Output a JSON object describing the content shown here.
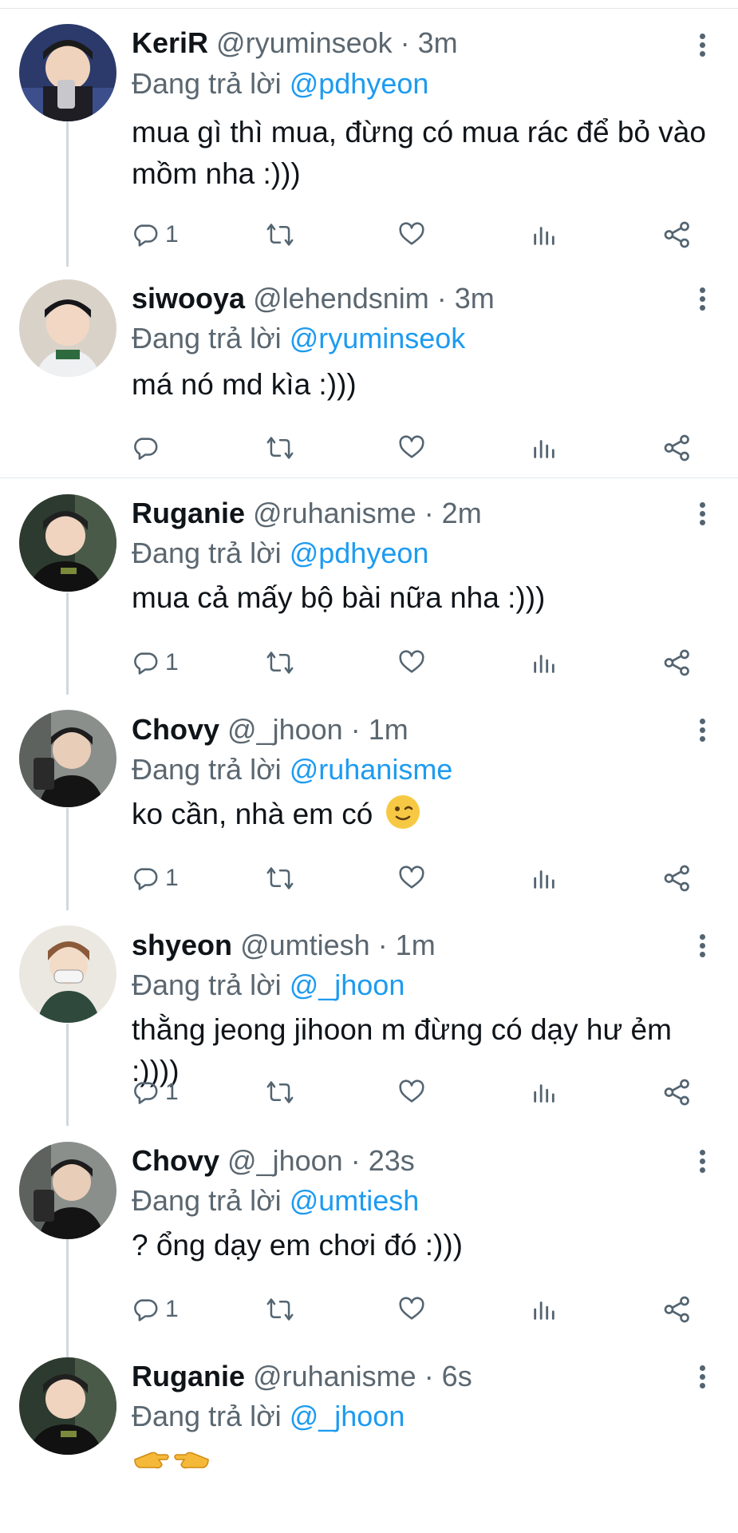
{
  "reply_prefix": "Đang trả lời",
  "tweets": [
    {
      "name": "KeriR",
      "handle": "@ryuminseok",
      "time": "· 3m",
      "reply_to": "@pdhyeon",
      "text": "mua gì thì mua, đừng có mua rác để bỏ vào mồm nha :)))",
      "replies": "1",
      "emoji": ""
    },
    {
      "name": "siwooya",
      "handle": "@lehendsnim",
      "time": "· 3m",
      "reply_to": "@ryuminseok",
      "text": "má nó md kìa :)))",
      "replies": "",
      "emoji": ""
    },
    {
      "name": "Ruganie",
      "handle": "@ruhanisme",
      "time": "· 2m",
      "reply_to": "@pdhyeon",
      "text": "mua cả mấy bộ bài nữa nha :)))",
      "replies": "1",
      "emoji": ""
    },
    {
      "name": "Chovy",
      "handle": "@_jhoon",
      "time": "· 1m",
      "reply_to": "@ruhanisme",
      "text": "ko cần, nhà em có",
      "replies": "1",
      "emoji": "winking-face"
    },
    {
      "name": "shyeon",
      "handle": "@umtiesh",
      "time": "· 1m",
      "reply_to": "@_jhoon",
      "text": "thằng jeong jihoon m đừng có dạy hư ẻm :))))",
      "replies": "1",
      "emoji": ""
    },
    {
      "name": "Chovy",
      "handle": "@_jhoon",
      "time": "· 23s",
      "reply_to": "@umtiesh",
      "text": "? ổng dạy em chơi đó :)))",
      "replies": "1",
      "emoji": ""
    },
    {
      "name": "Ruganie",
      "handle": "@ruhanisme",
      "time": "· 6s",
      "reply_to": "@_jhoon",
      "text": "",
      "replies": "",
      "emoji": "pointing-hands"
    }
  ],
  "colors": {
    "mention": "#1d9bf0",
    "muted": "#5b6770",
    "divider": "#e1e8ed"
  }
}
